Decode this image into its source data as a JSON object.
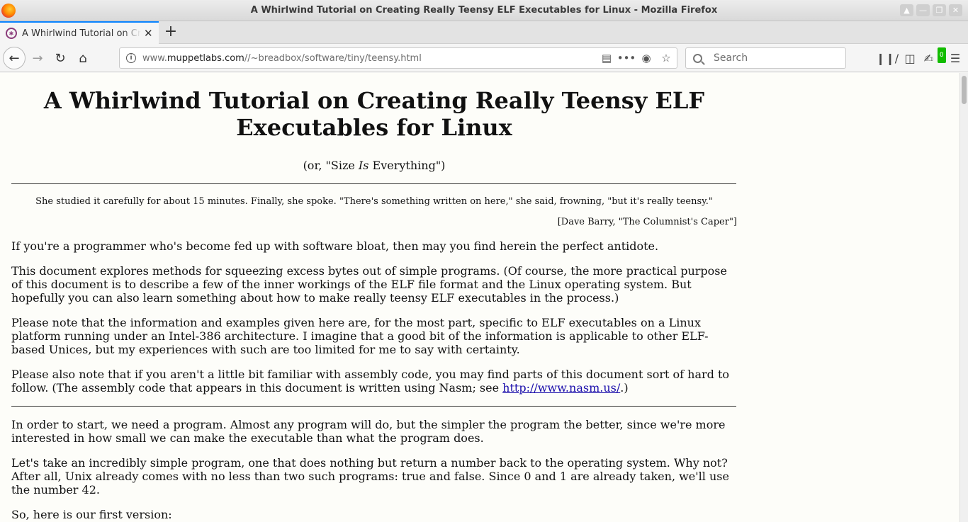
{
  "window": {
    "title": "A Whirlwind Tutorial on Creating Really Teensy ELF Executables for Linux - Mozilla Firefox"
  },
  "tabs": [
    {
      "label": "A Whirlwind Tutorial on Creating Really Teensy ELF Executables for Linux",
      "active": true
    }
  ],
  "nav": {
    "url_host": "www.muppetlabs.com",
    "url_prefix": "www.",
    "url_domain": "muppetlabs.com",
    "url_path": "//~breadbox/software/tiny/teensy.html",
    "search_placeholder": "Search",
    "extension_badge": "0"
  },
  "page": {
    "title": "A Whirlwind Tutorial on Creating Really Teensy ELF Executables for Linux",
    "subtitle_prefix": "(or, \"Size ",
    "subtitle_em": "Is",
    "subtitle_suffix": " Everything\")",
    "quote": "She studied it carefully for about 15 minutes. Finally, she spoke. \"There's something written on here,\" she said, frowning, \"but it's really teensy.\"",
    "attribution": "[Dave Barry, \"The Columnist's Caper\"]",
    "p1": "If you're a programmer who's become fed up with software bloat, then may you find herein the perfect antidote.",
    "p2": "This document explores methods for squeezing excess bytes out of simple programs. (Of course, the more practical purpose of this document is to describe a few of the inner workings of the ELF file format and the Linux operating system. But hopefully you can also learn something about how to make really teensy ELF executables in the process.)",
    "p3": "Please note that the information and examples given here are, for the most part, specific to ELF executables on a Linux platform running under an Intel-386 architecture. I imagine that a good bit of the information is applicable to other ELF-based Unices, but my experiences with such are too limited for me to say with certainty.",
    "p4_before": "Please also note that if you aren't a little bit familiar with assembly code, you may find parts of this document sort of hard to follow. (The assembly code that appears in this document is written using Nasm; see ",
    "p4_link": "http://www.nasm.us/",
    "p4_after": ".)",
    "p5": "In order to start, we need a program. Almost any program will do, but the simpler the program the better, since we're more interested in how small we can make the executable than what the program does.",
    "p6": "Let's take an incredibly simple program, one that does nothing but return a number back to the operating system. Why not? After all, Unix already comes with no less than two such programs: true and false. Since 0 and 1 are already taken, we'll use the number 42.",
    "p7": "So, here is our first version:"
  }
}
